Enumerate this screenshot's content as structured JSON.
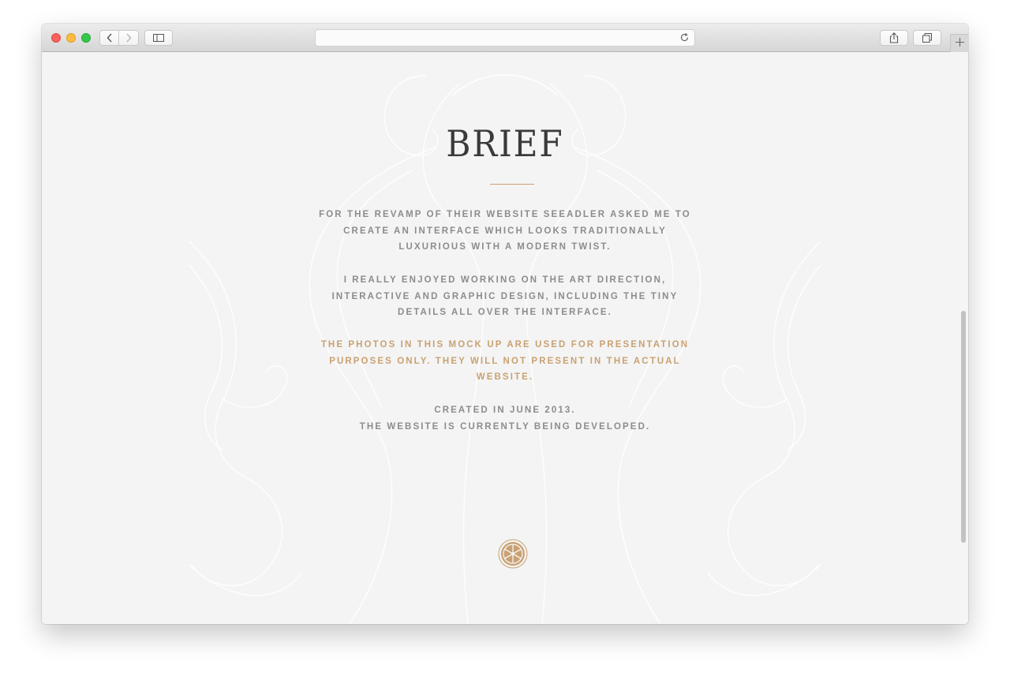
{
  "browser": {
    "address_value": "",
    "icons": {
      "back": "chevron-left-icon",
      "forward": "chevron-right-icon",
      "sidebar": "sidebar-icon",
      "reload": "reload-icon",
      "share": "share-icon",
      "tabs": "tabs-icon",
      "new_tab": "plus-icon"
    }
  },
  "page": {
    "title": "BRIEF",
    "paragraphs": {
      "intro": "FOR THE REVAMP OF THEIR WEBSITE SEEADLER ASKED ME TO CREATE AN INTERFACE WHICH LOOKS TRADITIONALLY LUXURIOUS WITH A MODERN TWIST.",
      "work": "I REALLY ENJOYED WORKING ON THE ART DIRECTION, INTERACTIVE AND GRAPHIC DESIGN, INCLUDING THE TINY DETAILS ALL OVER THE INTERFACE.",
      "notice": "THE PHOTOS IN THIS MOCK UP ARE USED FOR PRESENTATION PURPOSES ONLY. THEY WILL NOT PRESENT IN THE ACTUAL WEBSITE.",
      "created": "CREATED IN JUNE 2013.",
      "status": "THE WEBSITE IS CURRENTLY BEING DEVELOPED."
    },
    "emblem_icon": "lemon-slice-icon",
    "colors": {
      "background": "#f4f4f4",
      "title": "#3a3a3a",
      "body_text": "#8c8c8c",
      "accent": "#c9a172"
    }
  }
}
